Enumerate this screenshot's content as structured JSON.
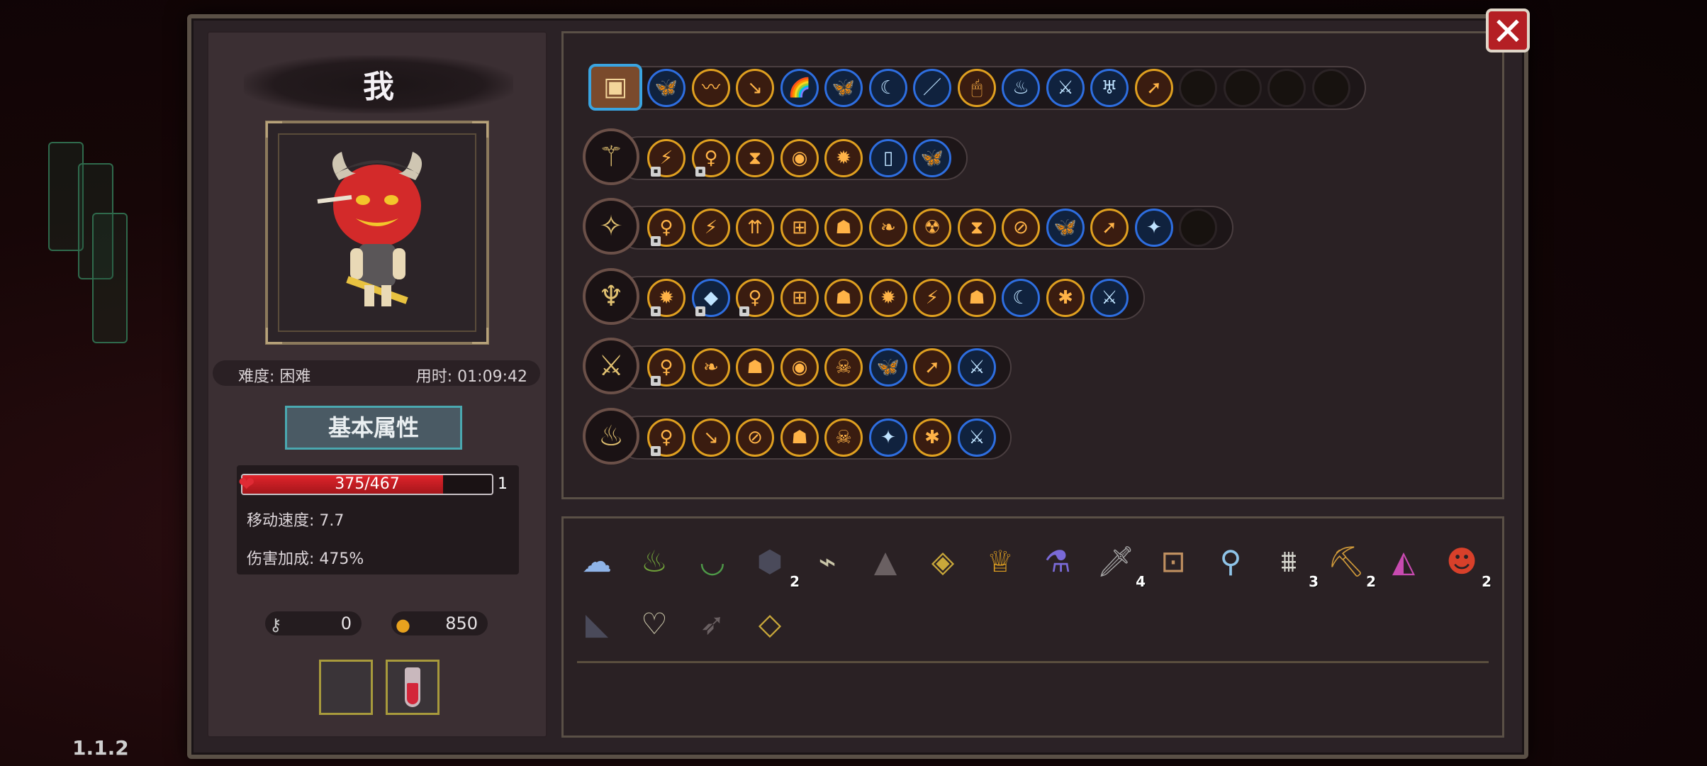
{
  "version": "1.1.2",
  "player": {
    "name": "我",
    "difficulty": "难度: 困难",
    "time": "用时: 01:09:42"
  },
  "tab_label": "基本属性",
  "stats": {
    "hp": "375/467",
    "hp_fraction": 0.803,
    "hp_count": "1",
    "move_speed": "移动速度: 7.7",
    "damage_bonus": "伤害加成: 475%"
  },
  "resources": {
    "keys": "0",
    "coins": "850"
  },
  "close_label": "✕",
  "colors": {
    "accent_blue": "#2e6ee0",
    "accent_orange": "#e0a020",
    "hp_red": "#e0242b",
    "close_red": "#b41f24"
  },
  "gem_rows": [
    {
      "weapon_icon": "chest-icon",
      "gems": [
        {
          "c": "b",
          "i": "🦋"
        },
        {
          "c": "o",
          "i": "〰"
        },
        {
          "c": "o",
          "i": "↘"
        },
        {
          "c": "b",
          "i": "🌈"
        },
        {
          "c": "b",
          "i": "🦋"
        },
        {
          "c": "b",
          "i": "☾"
        },
        {
          "c": "b",
          "i": "／"
        },
        {
          "c": "o",
          "i": "🖱"
        },
        {
          "c": "b",
          "i": "♨"
        },
        {
          "c": "b",
          "i": "⚔"
        },
        {
          "c": "b",
          "i": "♅"
        },
        {
          "c": "o",
          "i": "➚"
        },
        {
          "c": "e",
          "i": ""
        },
        {
          "c": "e",
          "i": ""
        },
        {
          "c": "e",
          "i": ""
        },
        {
          "c": "e",
          "i": ""
        }
      ]
    },
    {
      "weapon_icon": "staff-icon",
      "gems": [
        {
          "c": "o",
          "i": "⚡",
          "l": 1
        },
        {
          "c": "o",
          "i": "♀",
          "l": 1
        },
        {
          "c": "o",
          "i": "⧗"
        },
        {
          "c": "o",
          "i": "◉"
        },
        {
          "c": "o",
          "i": "✹"
        },
        {
          "c": "b",
          "i": "▯"
        },
        {
          "c": "b",
          "i": "🦋"
        }
      ]
    },
    {
      "weapon_icon": "wand-icon",
      "gems": [
        {
          "c": "o",
          "i": "♀",
          "l": 1
        },
        {
          "c": "o",
          "i": "⚡"
        },
        {
          "c": "o",
          "i": "⇈"
        },
        {
          "c": "o",
          "i": "⊞"
        },
        {
          "c": "o",
          "i": "☗"
        },
        {
          "c": "o",
          "i": "❧"
        },
        {
          "c": "o",
          "i": "☢"
        },
        {
          "c": "o",
          "i": "⧗"
        },
        {
          "c": "o",
          "i": "⊘"
        },
        {
          "c": "b",
          "i": "🦋"
        },
        {
          "c": "o",
          "i": "➚"
        },
        {
          "c": "b",
          "i": "✦"
        },
        {
          "c": "e",
          "i": ""
        }
      ]
    },
    {
      "weapon_icon": "scepter-icon",
      "gems": [
        {
          "c": "o",
          "i": "✹",
          "l": 1
        },
        {
          "c": "b",
          "i": "◆",
          "l": 1
        },
        {
          "c": "o",
          "i": "♀",
          "l": 1
        },
        {
          "c": "o",
          "i": "⊞"
        },
        {
          "c": "o",
          "i": "☗"
        },
        {
          "c": "o",
          "i": "✹"
        },
        {
          "c": "o",
          "i": "⚡"
        },
        {
          "c": "o",
          "i": "☗"
        },
        {
          "c": "b",
          "i": "☾"
        },
        {
          "c": "o",
          "i": "✱"
        },
        {
          "c": "b",
          "i": "⚔"
        }
      ]
    },
    {
      "weapon_icon": "dagger-icon",
      "gems": [
        {
          "c": "o",
          "i": "♀",
          "l": 1
        },
        {
          "c": "o",
          "i": "❧"
        },
        {
          "c": "o",
          "i": "☗"
        },
        {
          "c": "o",
          "i": "◉"
        },
        {
          "c": "o",
          "i": "☠"
        },
        {
          "c": "b",
          "i": "🦋"
        },
        {
          "c": "o",
          "i": "➚"
        },
        {
          "c": "b",
          "i": "⚔"
        }
      ]
    },
    {
      "weapon_icon": "torch-icon",
      "gems": [
        {
          "c": "o",
          "i": "♀",
          "l": 1
        },
        {
          "c": "o",
          "i": "↘"
        },
        {
          "c": "o",
          "i": "⊘"
        },
        {
          "c": "o",
          "i": "☗"
        },
        {
          "c": "o",
          "i": "☠"
        },
        {
          "c": "b",
          "i": "✦"
        },
        {
          "c": "o",
          "i": "✱"
        },
        {
          "c": "b",
          "i": "⚔"
        }
      ]
    }
  ],
  "items_row1": [
    {
      "i": "☁",
      "n": "mask-item-icon",
      "c": ""
    },
    {
      "i": "♨",
      "n": "boot-item-icon",
      "c": ""
    },
    {
      "i": "◡",
      "n": "belt-item-icon",
      "c": ""
    },
    {
      "i": "⬢",
      "n": "orb-item-icon",
      "c": "2"
    },
    {
      "i": "⌁",
      "n": "bone-item-icon",
      "c": ""
    },
    {
      "i": "▲",
      "n": "cloak-item-icon",
      "c": ""
    },
    {
      "i": "◈",
      "n": "cube-item-icon",
      "c": ""
    },
    {
      "i": "♕",
      "n": "goblet-item-icon",
      "c": ""
    },
    {
      "i": "⚗",
      "n": "potion-item-icon",
      "c": ""
    },
    {
      "i": "🗡",
      "n": "sword-item-icon",
      "c": "4"
    },
    {
      "i": "⊡",
      "n": "lantern-item-icon",
      "c": ""
    },
    {
      "i": "⚲",
      "n": "magnifier-item-icon",
      "c": ""
    },
    {
      "i": "⩩",
      "n": "teeth-item-icon",
      "c": "3"
    },
    {
      "i": "⛏",
      "n": "pickaxe-item-icon",
      "c": "2"
    },
    {
      "i": "◭",
      "n": "rainbow-shield-item-icon",
      "c": ""
    },
    {
      "i": "☻",
      "n": "demon-mask-item-icon",
      "c": "2"
    }
  ],
  "items_row2": [
    {
      "i": "◣",
      "n": "purple-boot-item-icon",
      "c": ""
    },
    {
      "i": "♡",
      "n": "amulet-item-icon",
      "c": ""
    },
    {
      "i": "➶",
      "n": "arrow-item-icon",
      "c": ""
    },
    {
      "i": "◇",
      "n": "crystal-item-icon",
      "c": ""
    }
  ]
}
